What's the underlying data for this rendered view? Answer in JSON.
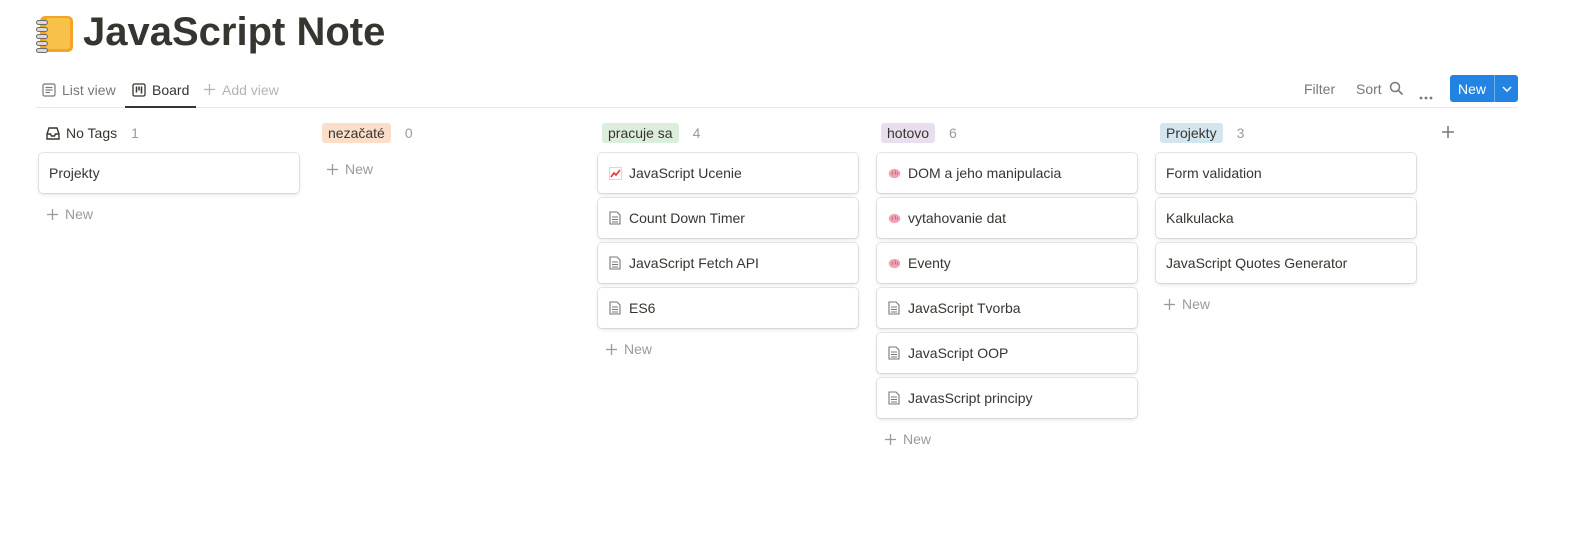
{
  "page": {
    "title": "JavaScript Note",
    "icon": "notebook-icon"
  },
  "tabs": {
    "list_view": "List view",
    "board": "Board",
    "add_view": "Add view"
  },
  "toolbar": {
    "filter": "Filter",
    "sort": "Sort",
    "new": "New"
  },
  "columns": [
    {
      "name": "No Tags",
      "count": "1",
      "color": "",
      "cards": [
        {
          "title": "Projekty",
          "icon": ""
        }
      ],
      "new_label": "New"
    },
    {
      "name": "nezačaté",
      "count": "0",
      "color": "#fadec9",
      "cards": [],
      "new_label": "New"
    },
    {
      "name": "pracuje sa",
      "count": "4",
      "color": "#dbeddb",
      "cards": [
        {
          "title": "JavaScript Ucenie",
          "icon": "chart-increasing-icon"
        },
        {
          "title": "Count Down Timer",
          "icon": "page-icon"
        },
        {
          "title": "JavaScript Fetch API",
          "icon": "page-icon"
        },
        {
          "title": "ES6",
          "icon": "page-icon"
        }
      ],
      "new_label": "New"
    },
    {
      "name": "hotovo",
      "count": "6",
      "color": "#e8deee",
      "cards": [
        {
          "title": "DOM a jeho manipulacia",
          "icon": "brain-icon"
        },
        {
          "title": "vytahovanie dat",
          "icon": "brain-icon"
        },
        {
          "title": "Eventy",
          "icon": "brain-icon"
        },
        {
          "title": "JavaScript Tvorba",
          "icon": "page-icon"
        },
        {
          "title": "JavaScript OOP",
          "icon": "page-icon"
        },
        {
          "title": "JavasScript principy",
          "icon": "page-icon"
        }
      ],
      "new_label": "New"
    },
    {
      "name": "Projekty",
      "count": "3",
      "color": "#d3e5ef",
      "cards": [
        {
          "title": "Form validation",
          "icon": ""
        },
        {
          "title": "Kalkulacka",
          "icon": ""
        },
        {
          "title": "JavaScript Quotes Generator",
          "icon": ""
        }
      ],
      "new_label": "New"
    }
  ],
  "colors": {
    "accent": "#2383e2",
    "text": "#37352f",
    "muted": "#9b9a97"
  }
}
